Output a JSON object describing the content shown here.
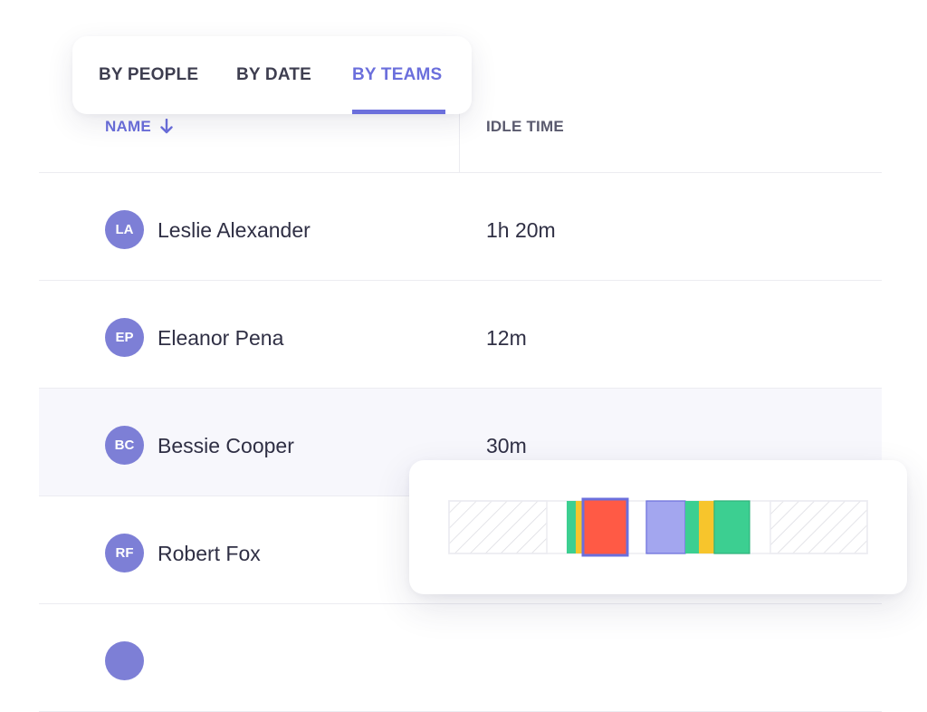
{
  "tabs": [
    {
      "label": "BY PEOPLE",
      "active": false
    },
    {
      "label": "BY DATE",
      "active": false
    },
    {
      "label": "BY TEAMS",
      "active": true
    }
  ],
  "columns": {
    "name": "NAME",
    "idle": "IDLE TIME"
  },
  "rows": [
    {
      "initials": "LA",
      "name": "Leslie Alexander",
      "idle": "1h 20m"
    },
    {
      "initials": "EP",
      "name": "Eleanor Pena",
      "idle": "12m"
    },
    {
      "initials": "BC",
      "name": "Bessie Cooper",
      "idle": "30m",
      "active": true
    },
    {
      "initials": "RF",
      "name": "Robert Fox",
      "idle": ""
    }
  ],
  "colors": {
    "accent": "#6b6fdc",
    "avatar": "#7d7fd6",
    "green": "#3ccf91",
    "yellow": "#f7c52c",
    "red": "#ff5a45",
    "lavender": "#a3a6ef",
    "hatch": "#e3e3e8"
  },
  "timeline": {
    "segments": [
      "hatched",
      "empty",
      "green",
      "yellow",
      "red-selected",
      "empty",
      "lavender",
      "green",
      "yellow",
      "green",
      "empty",
      "hatched"
    ]
  }
}
